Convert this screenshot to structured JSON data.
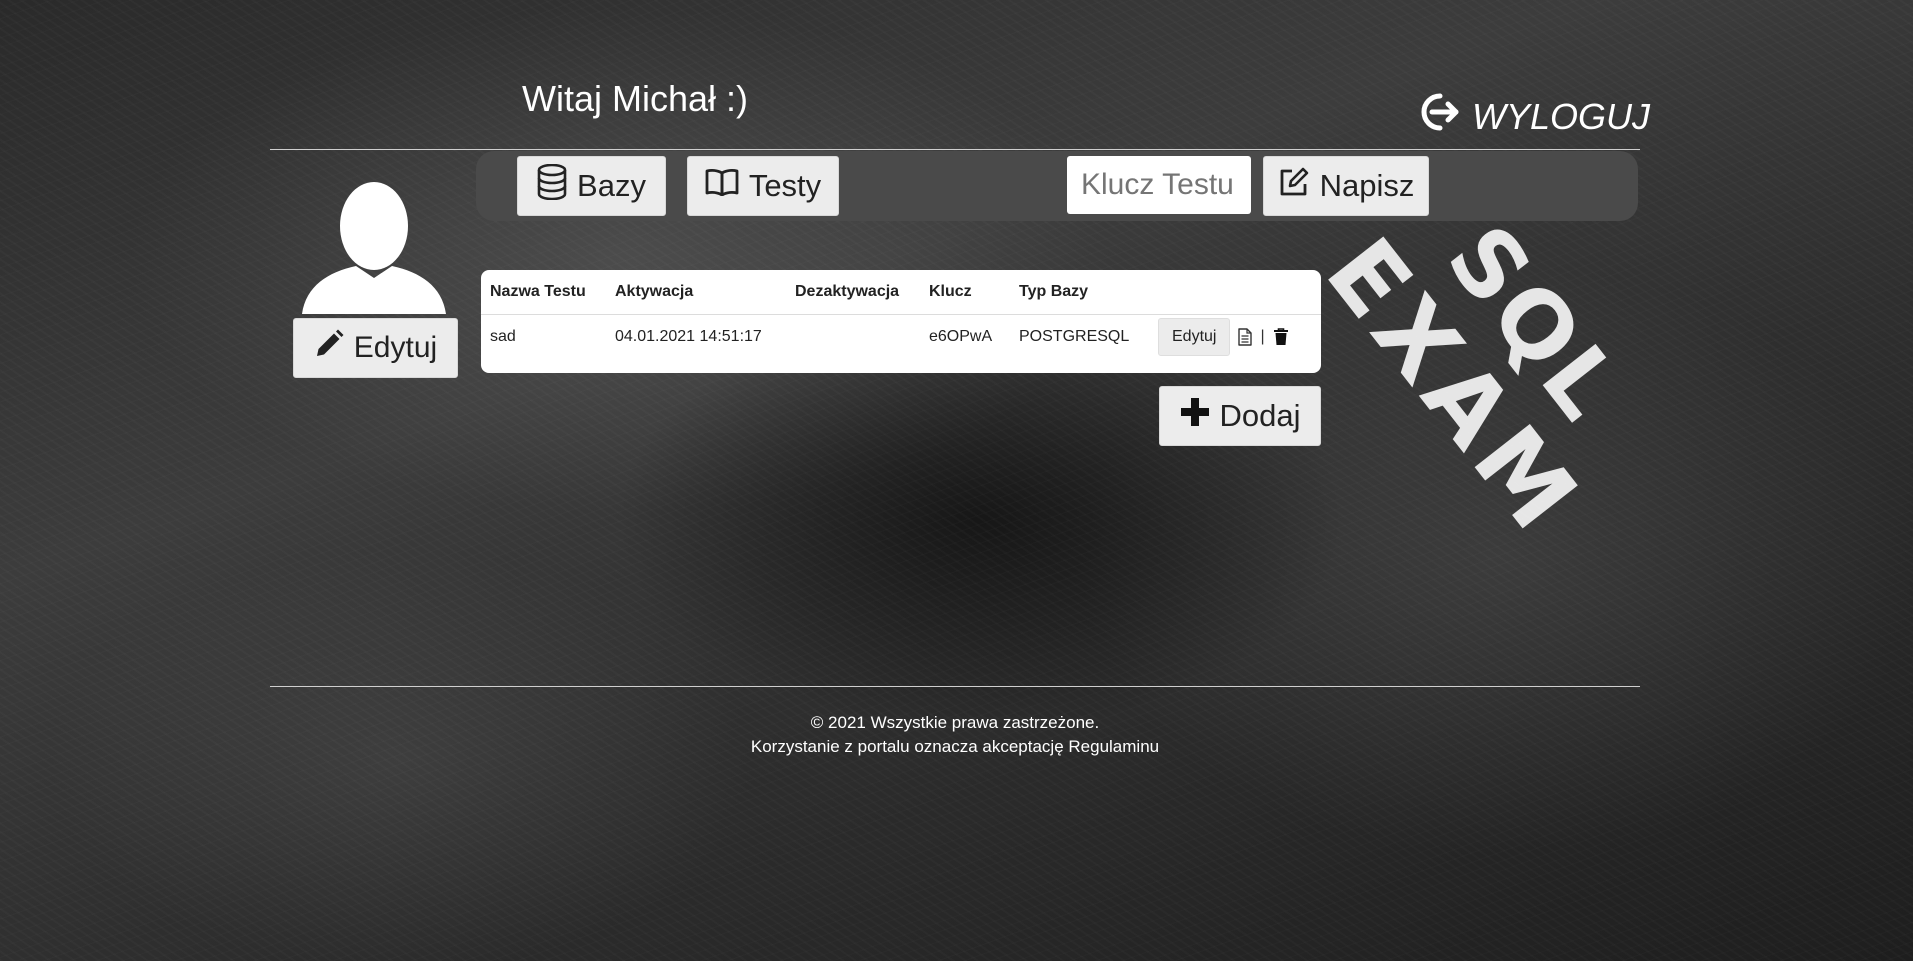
{
  "header": {
    "welcome": "Witaj Michał :)",
    "logout_label": "WYLOGUJ"
  },
  "toolbar": {
    "bazy_label": "Bazy",
    "testy_label": "Testy",
    "key_placeholder": "Klucz Testu",
    "key_value": "",
    "napisz_label": "Napisz"
  },
  "profile": {
    "edit_label": "Edytuj"
  },
  "table": {
    "headers": [
      "Nazwa Testu",
      "Aktywacja",
      "Dezaktywacja",
      "Klucz",
      "Typ Bazy"
    ],
    "rows": [
      {
        "name": "sad",
        "activation": "04.01.2021 14:51:17",
        "deactivation": "",
        "key": "e6OPwA",
        "db_type": "POSTGRESQL",
        "edit_label": "Edytuj",
        "separator": "|"
      }
    ]
  },
  "add_label": "Dodaj",
  "footer": {
    "line1": "© 2021 Wszystkie prawa zastrzeżone.",
    "line2": "Korzystanie z portalu oznacza akceptację Regulaminu"
  },
  "logo": {
    "line1": "SQL",
    "line2": "EXAM"
  },
  "icons": {
    "logout": "sign-out-icon",
    "bazy": "database-icon",
    "testy": "book-open-icon",
    "napisz": "edit-square-icon",
    "profile_edit": "pencil-icon",
    "row_details": "file-text-icon",
    "row_delete": "trash-icon",
    "add": "plus-icon"
  }
}
